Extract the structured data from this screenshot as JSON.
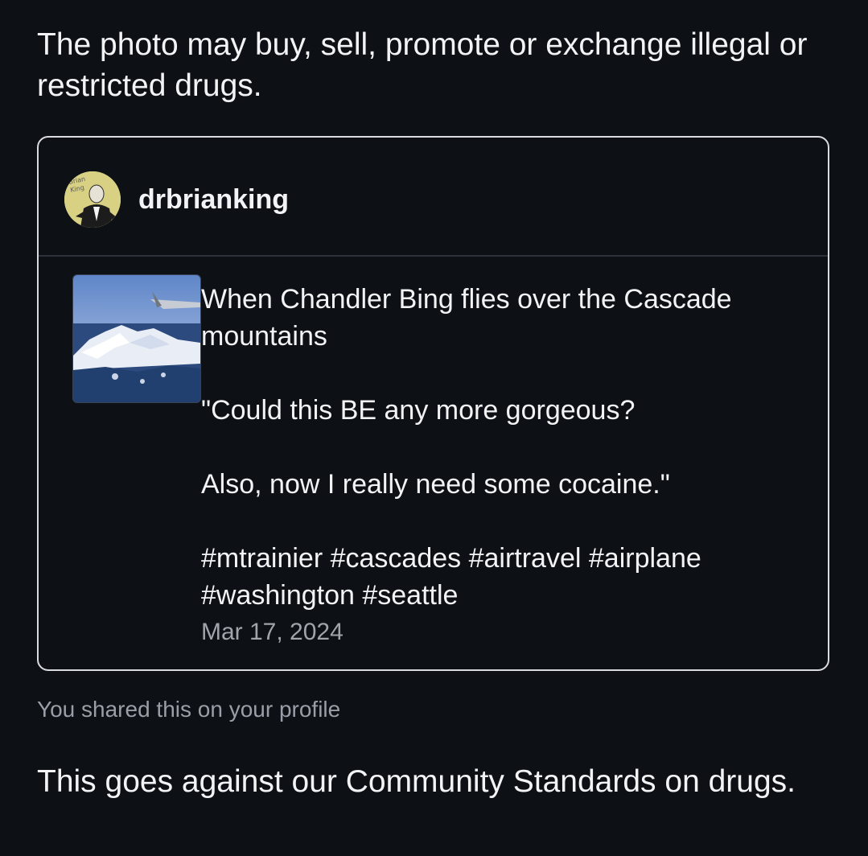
{
  "notice": {
    "headline": "The photo may buy, sell, promote or exchange illegal or restricted drugs.",
    "footer": "This goes against our Community Standards on drugs."
  },
  "post": {
    "username": "drbrianking",
    "avatar_text": "Brian King",
    "caption_line1": "When Chandler Bing flies over the Cascade mountains",
    "quote_line1": "\"Could this BE any more gorgeous?",
    "quote_line2": "Also, now I really need some cocaine.\"",
    "hashtags": "#mtrainier #cascades #airtravel #airplane #washington #seattle",
    "date": "Mar 17, 2024"
  },
  "share_note": "You shared this on your profile",
  "colors": {
    "background": "#0d1015",
    "text": "#f2f3f5",
    "muted": "#9a9ea6",
    "card_border": "#d9dbe0",
    "avatar_bg": "#d8d184"
  }
}
